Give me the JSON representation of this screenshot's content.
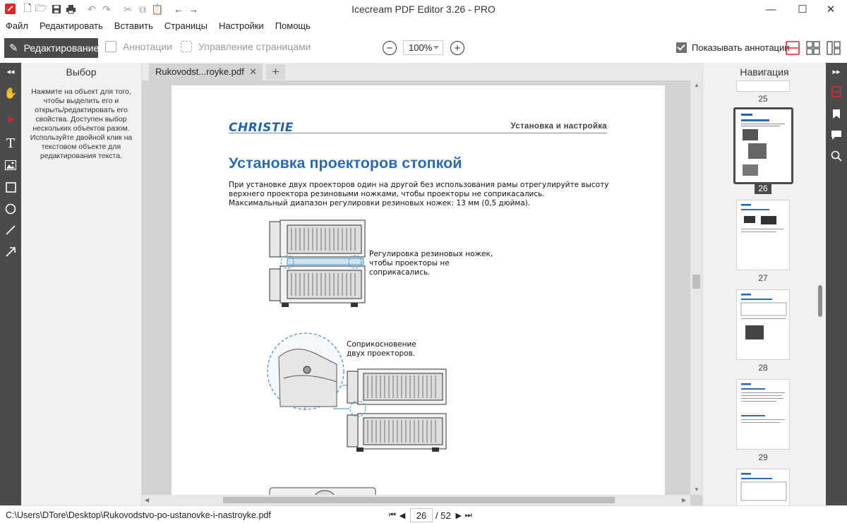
{
  "window": {
    "title": "Icecream PDF Editor 3.26 - PRO",
    "minimize_glyph": "—",
    "maximize_glyph": "☐",
    "close_glyph": "✕"
  },
  "menu": [
    "Файл",
    "Редактировать",
    "Вставить",
    "Страницы",
    "Настройки",
    "Помощь"
  ],
  "toolbar": {
    "mode_edit": "Редактирование",
    "mode_annotations": "Аннотации",
    "mode_pages": "Управление страницами",
    "zoom": "100%",
    "show_annotations": "Показывать аннотации"
  },
  "left_panel": {
    "title": "Выбор",
    "help": "Нажмите на объект для того, чтобы выделить его и открыть/редактировать его свойства. Доступен выбор нескольких объектов разом. Используйте двойной клик на текстовом объекте для редактирования текста."
  },
  "tab": {
    "label": "Rukovodst...royke.pdf",
    "close": "✕",
    "new": "+"
  },
  "document": {
    "logo": "CHRISTIE",
    "header": "Установка и настройка",
    "heading": "Установка проекторов стопкой",
    "body": "При установке двух проекторов один на другой без использования рамы отрегулируйте высоту\nверхнего проектора резиновыми ножками, чтобы проекторы не соприкасались.\nМаксимальный диапазон регулировки резиновых ножек: 13 мм (0,5 дюйма).",
    "callout_feet": "Регулировка резиновых ножек,\nчтобы проекторы не\nсоприкасались.",
    "callout_contact": "Соприкосновение\nдвух проекторов."
  },
  "navigation": {
    "title": "Навигация",
    "pages": [
      "25",
      "26",
      "27",
      "28",
      "29"
    ],
    "selected_page": "26"
  },
  "status": {
    "path": "C:\\Users\\DTore\\Desktop\\Rukovodstvo-po-ustanovke-i-nastroyke.pdf",
    "current_page": "26",
    "total_pages": "/ 52"
  },
  "colors": {
    "accent": "#e0262d",
    "dark_panel": "#4b4b4b",
    "heading_blue": "#2a6bb3"
  }
}
